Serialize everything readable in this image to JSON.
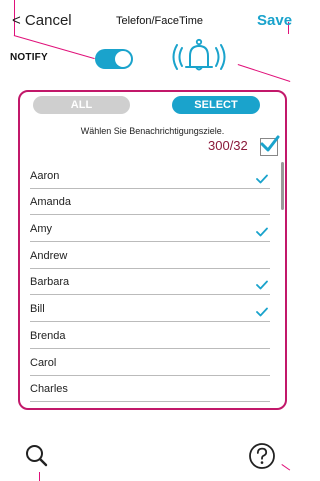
{
  "header": {
    "cancel_label": "< Cancel",
    "title": "Telefon/FaceTime",
    "save_label": "Save"
  },
  "notify": {
    "label": "NOTIFY",
    "enabled": true
  },
  "filter": {
    "all_label": "ALL",
    "select_label": "SELECT",
    "selected": "SELECT"
  },
  "hint": "Wählen Sie Benachrichtigungsziele.",
  "count": "300/32",
  "contacts": [
    {
      "name": "Aaron",
      "checked": true
    },
    {
      "name": "Amanda",
      "checked": false
    },
    {
      "name": "Amy",
      "checked": true
    },
    {
      "name": "Andrew",
      "checked": false
    },
    {
      "name": "Barbara",
      "checked": true
    },
    {
      "name": "Bill",
      "checked": true
    },
    {
      "name": "Brenda",
      "checked": false
    },
    {
      "name": "Carol",
      "checked": false
    },
    {
      "name": "Charles",
      "checked": false
    }
  ],
  "colors": {
    "accent": "#1aa3cc",
    "highlight": "#c2186a",
    "count": "#8b1a3a"
  },
  "icons": [
    "bell-icon",
    "search-icon",
    "help-icon",
    "check-icon"
  ]
}
